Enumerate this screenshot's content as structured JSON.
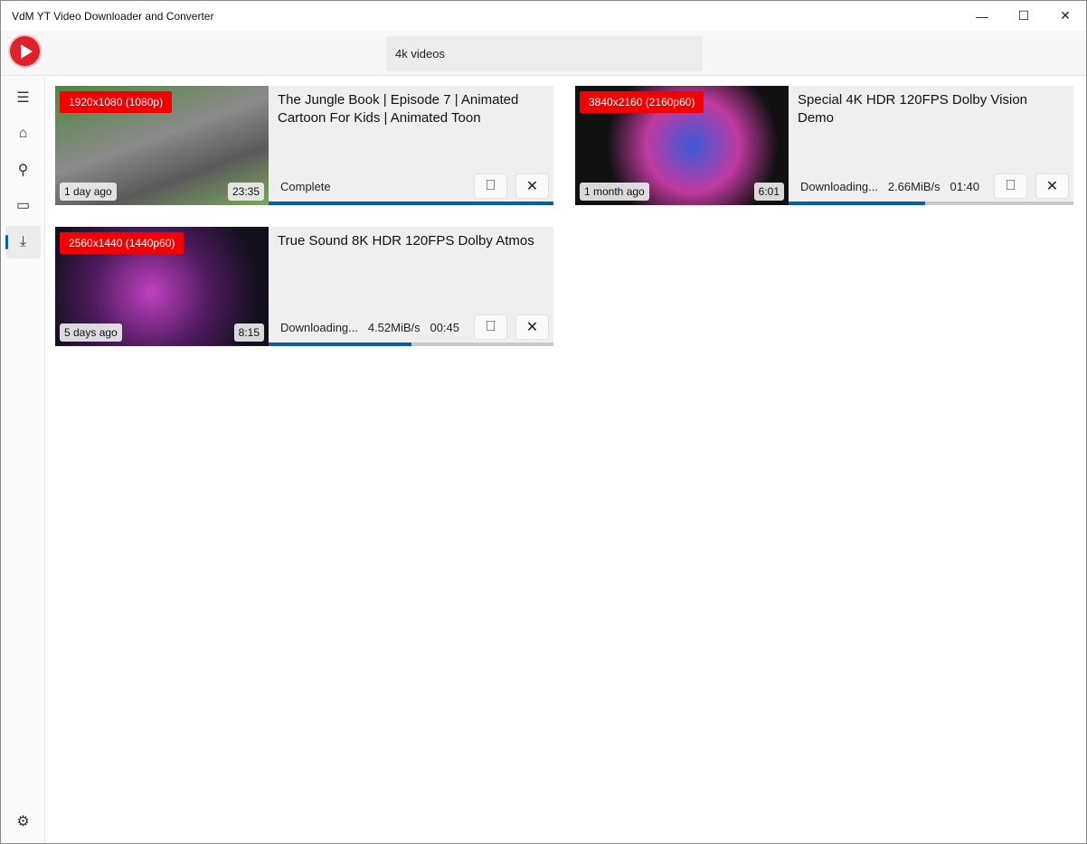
{
  "window": {
    "title": "VdM YT Video Downloader and Converter",
    "minimize": "—",
    "maximize": "☐",
    "close": "✕"
  },
  "search": {
    "value": "4k videos"
  },
  "sidebar": {
    "items": [
      {
        "name": "menu",
        "glyph": "☰"
      },
      {
        "name": "home",
        "glyph": "⌂"
      },
      {
        "name": "search",
        "glyph": "⚲"
      },
      {
        "name": "video",
        "glyph": "▭"
      },
      {
        "name": "downloads",
        "glyph": "⤓"
      }
    ],
    "settings": "⚙"
  },
  "accent": "#0a5ea8",
  "downloads": [
    {
      "resolution": "1920x1080 (1080p)",
      "title": "The Jungle Book | Episode 7 | Animated Cartoon For Kids | Animated Toon",
      "ago": "1 day ago",
      "duration": "23:35",
      "status": "Complete",
      "progress": 100
    },
    {
      "resolution": "3840x2160 (2160p60)",
      "title": "Special 4K HDR 120FPS Dolby Vision Demo",
      "ago": "1 month ago",
      "duration": "6:01",
      "status": "Downloading...   2.66MiB/s   01:40",
      "progress": 48
    },
    {
      "resolution": "2560x1440 (1440p60)",
      "title": "True Sound 8K HDR 120FPS Dolby Atmos",
      "ago": "5 days ago",
      "duration": "8:15",
      "status": "Downloading...   4.52MiB/s   00:45",
      "progress": 50
    }
  ],
  "actions": {
    "open": "⎕",
    "remove": "✕"
  }
}
